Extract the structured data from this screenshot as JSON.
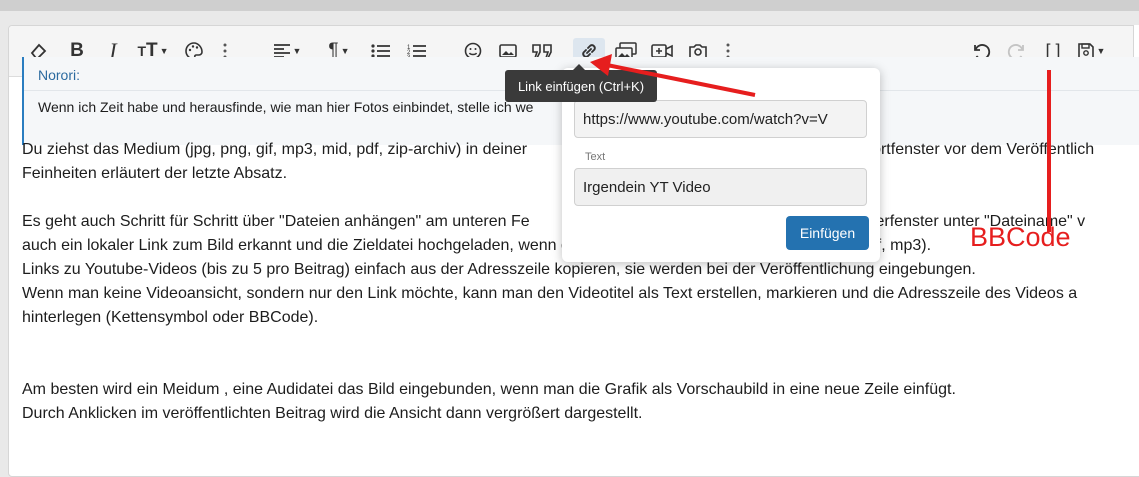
{
  "toolbar": {
    "icons": [
      "eraser-icon",
      "bold-icon",
      "italic-icon",
      "text-size-icon",
      "palette-icon",
      "more-icon",
      "align-icon",
      "paragraph-icon",
      "bullet-list-icon",
      "numbered-list-icon",
      "smiley-icon",
      "image-icon",
      "quote-icon",
      "link-icon",
      "media-gallery-icon",
      "video-icon",
      "camera-icon",
      "more-icon-2",
      "undo-icon",
      "redo-icon",
      "bbcode-toggle-icon",
      "save-draft-icon"
    ]
  },
  "tooltip": {
    "text": "Link einfügen (Ctrl+K)"
  },
  "quote": {
    "author": "Norori:",
    "text": "Wenn ich Zeit habe und herausfinde, wie man hier Fotos einbindet, stelle ich we"
  },
  "body": {
    "lines": [
      "Du ziehst das Medium (jpg, png, gif, mp3, mid, pdf, zip-archiv) in deiner                                                                        ntwortfenster vor dem Veröffentlich",
      "Feinheiten erläutert der letzte Absatz.",
      "",
      "Es geht auch Schritt für Schritt über \"Dateien anhängen\" am unteren Fe                                                                      xplorerfenster unter \"Dateiname\" v",
      "auch ein lokaler Link zum Bild erkannt und die Zieldatei hochgeladen, wenn die Dateiendung zugelassen ist (jpg, png, pdf, mp3).",
      "Links zu Youtube-Videos (bis zu 5 pro Beitrag) einfach aus der Adresszeile kopieren, sie werden bei der Veröffentlichung eingebungen.",
      "Wenn man keine Videoansicht, sondern nur den Link möchte, kann man den Videotitel als Text erstellen, markieren und die Adresszeile des Videos a",
      "hinterlegen (Kettensymbol oder BBCode).",
      "",
      "",
      "Am besten wird ein Meidum , eine Audidatei das Bild eingebunden, wenn man die Grafik als Vorschaubild in eine neue Zeile einfügt.",
      "Durch Anklicken im veröffentlichten Beitrag wird die Ansicht dann vergrößert dargestellt."
    ]
  },
  "popup": {
    "url_value": "https://www.youtube.com/watch?v=V",
    "text_label": "Text",
    "text_value": "Irgendein YT Video",
    "insert_label": "Einfügen"
  },
  "annotation": {
    "label": "BBCode",
    "color": "#e61e1e"
  }
}
